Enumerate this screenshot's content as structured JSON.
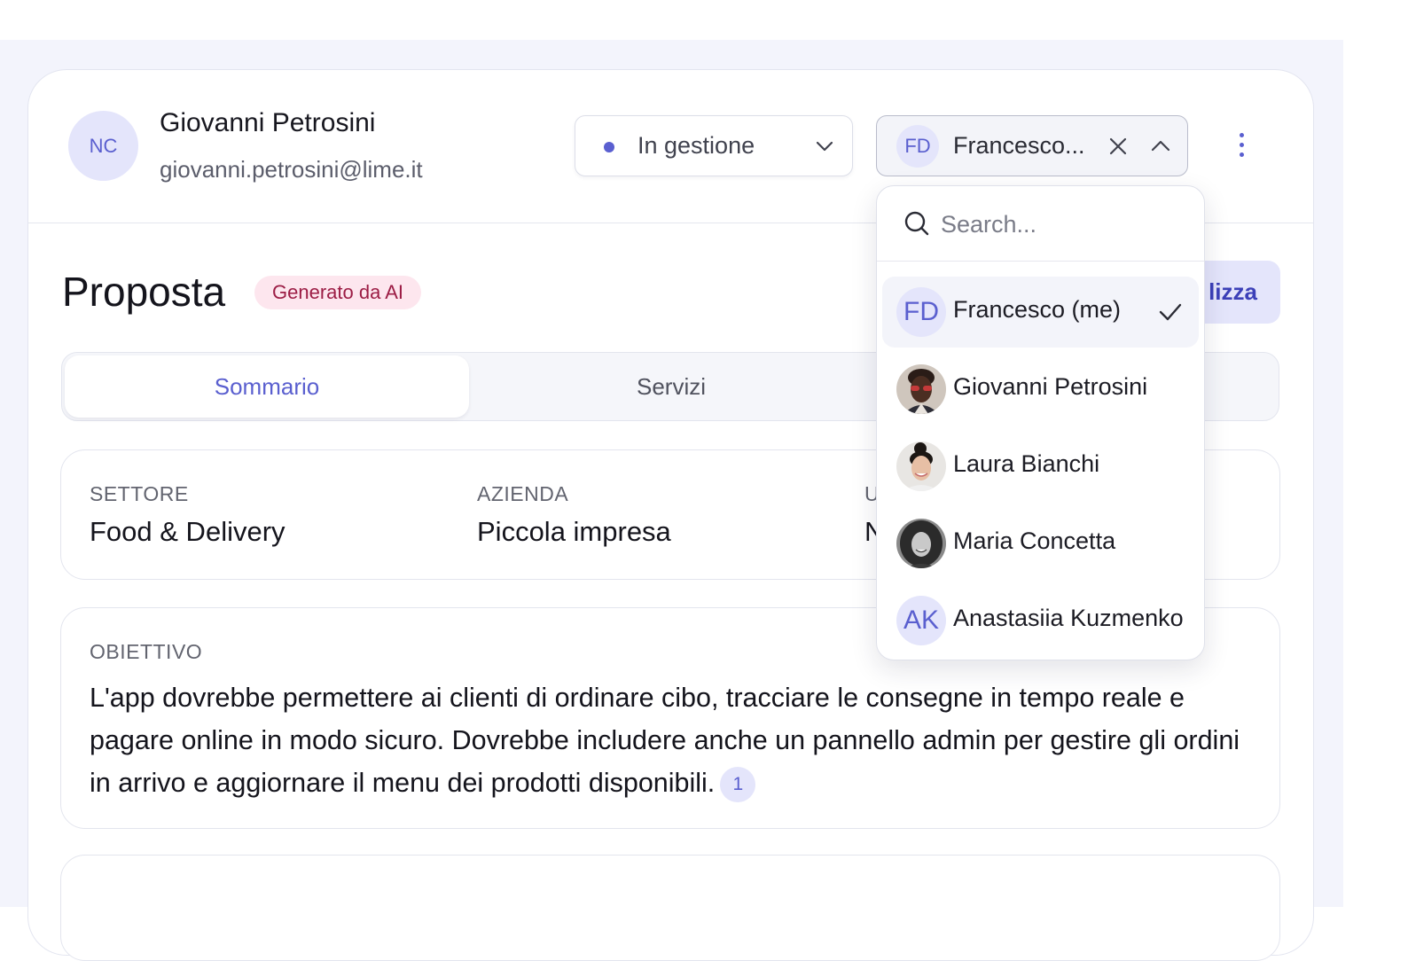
{
  "customer": {
    "initials": "NC",
    "name": "Giovanni Petrosini",
    "email": "giovanni.petrosini@lime.it"
  },
  "status": {
    "label": "In gestione",
    "dot_color": "#5a5fd0"
  },
  "assignee": {
    "initials": "FD",
    "label": "Francesco..."
  },
  "proposal": {
    "title": "Proposta",
    "ai_badge": "Generato da AI",
    "finalize_label": "lizza"
  },
  "tabs": [
    {
      "label": "Sommario",
      "active": true
    },
    {
      "label": "Servizi",
      "active": false
    }
  ],
  "info": [
    {
      "label": "SETTORE",
      "value": "Food & Delivery"
    },
    {
      "label": "AZIENDA",
      "value": "Piccola impresa"
    },
    {
      "label": "U",
      "value": "N"
    }
  ],
  "goal": {
    "label": "OBIETTIVO",
    "text": "L'app dovrebbe permettere ai clienti di ordinare cibo, tracciare le consegne in tempo reale e pagare online in modo sicuro. Dovrebbe includere anche un pannello admin per gestire gli ordini in arrivo e aggiornare il menu dei prodotti disponibili.",
    "reference": "1"
  },
  "assignee_dropdown": {
    "search_placeholder": "Search...",
    "options": [
      {
        "label": "Francesco (me)",
        "initials": "FD",
        "selected": true
      },
      {
        "label": "Giovanni Petrosini",
        "photo": "dark-skin-man"
      },
      {
        "label": "Laura Bianchi",
        "photo": "woman-bun"
      },
      {
        "label": "Maria Concetta",
        "photo": "woman-curly"
      },
      {
        "label": "Anastasiia Kuzmenko",
        "initials": "AK"
      }
    ]
  },
  "colors": {
    "accent": "#5a5fcf",
    "accent_soft": "#e4e5fb",
    "ai_badge_bg": "#fde6ee",
    "ai_badge_text": "#9c1d45",
    "page_background": "#f3f4fc"
  }
}
